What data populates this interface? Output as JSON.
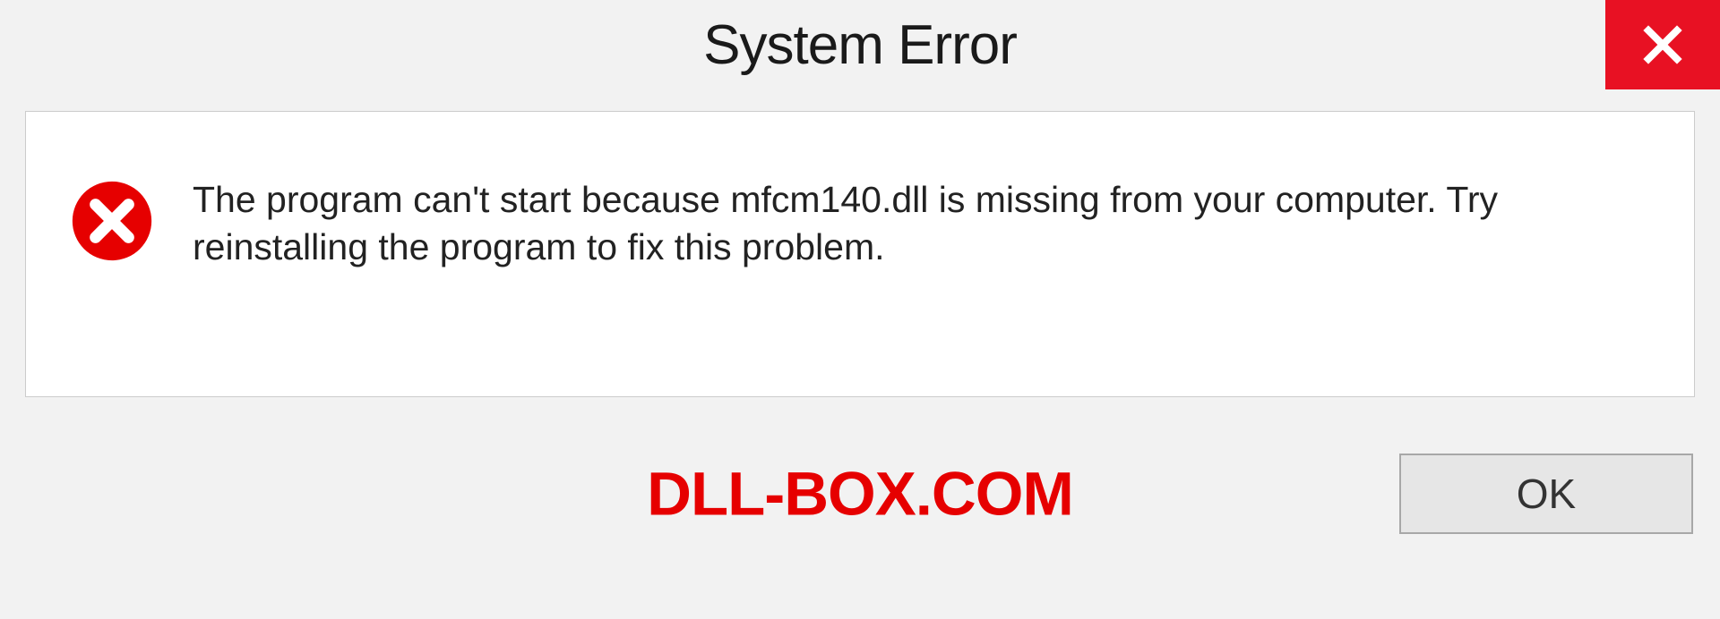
{
  "title": "System Error",
  "message": "The program can't start because mfcm140.dll is missing from your computer. Try reinstalling the program to fix this problem.",
  "watermark": "DLL-BOX.COM",
  "ok_label": "OK",
  "colors": {
    "close_bg": "#e81123",
    "error_icon": "#e60000",
    "watermark": "#e60000"
  }
}
